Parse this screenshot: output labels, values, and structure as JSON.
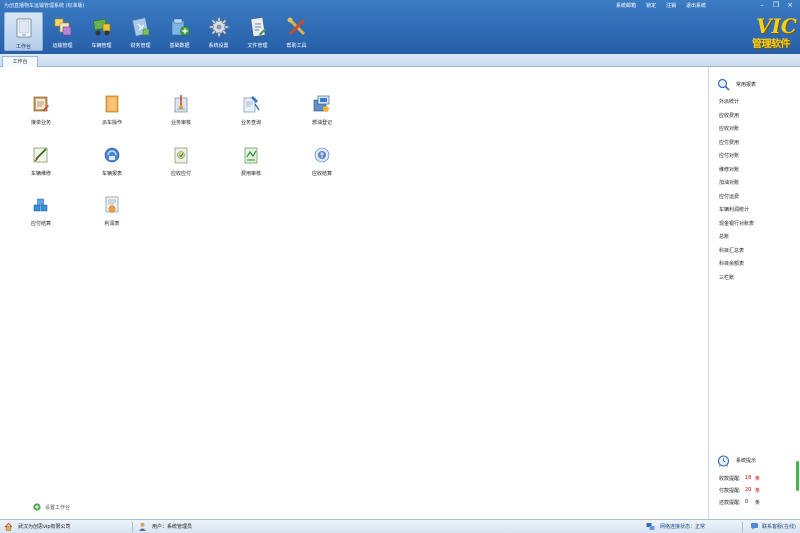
{
  "window": {
    "title": "为创直播物车运输管理系统 (标准版)",
    "top_links": [
      "系统邮箱",
      "锁定",
      "注销",
      "退出系统"
    ],
    "controls": [
      "minimize",
      "restore",
      "close"
    ]
  },
  "toolbar": [
    {
      "label": "工作台",
      "icon": "workbench-icon",
      "active": true
    },
    {
      "label": "运输管理",
      "icon": "transport-icon",
      "active": false
    },
    {
      "label": "车辆管理",
      "icon": "vehicle-icon",
      "active": false
    },
    {
      "label": "财务管理",
      "icon": "finance-icon",
      "active": false
    },
    {
      "label": "基础数据",
      "icon": "basedata-icon",
      "active": false
    },
    {
      "label": "系统设置",
      "icon": "gear-icon",
      "active": false
    },
    {
      "label": "文件管理",
      "icon": "file-icon",
      "active": false
    },
    {
      "label": "帮助工具",
      "icon": "tools-icon",
      "active": false
    }
  ],
  "logo": {
    "vic": "VIC",
    "sub": "管理软件"
  },
  "tabs": [
    {
      "label": "工作台"
    }
  ],
  "workspace": {
    "items": [
      {
        "label": "接单业务",
        "icon": "order-icon"
      },
      {
        "label": "派车操作",
        "icon": "dispatch-icon"
      },
      {
        "label": "业务审核",
        "icon": "audit-icon"
      },
      {
        "label": "业务查询",
        "icon": "query-icon"
      },
      {
        "label": "燃油登记",
        "icon": "fuel-icon"
      },
      {
        "label": "车辆维修",
        "icon": "repair-icon"
      },
      {
        "label": "车辆报表",
        "icon": "vehicle-report-icon"
      },
      {
        "label": "应收应付",
        "icon": "receivable-icon"
      },
      {
        "label": "费用审核",
        "icon": "expense-audit-icon"
      },
      {
        "label": "应收结算",
        "icon": "receivable-settle-icon"
      },
      {
        "label": "应付结算",
        "icon": "payable-settle-icon"
      },
      {
        "label": "利润表",
        "icon": "profit-icon"
      }
    ],
    "setup_label": "设置工作台"
  },
  "reports": {
    "title": "常用报表",
    "items": [
      "外派统计",
      "应收费用",
      "应收对账",
      "应付费用",
      "应付对账",
      "维修对账",
      "加油对账",
      "应付运费",
      "车辆利润统计",
      "现金银行对账表",
      "总账",
      "科目汇总表",
      "科目余额表",
      "三栏账"
    ]
  },
  "tips": {
    "title": "系统提示",
    "items": [
      {
        "label": "收款提醒:",
        "value": "18",
        "unit": "条",
        "highlight": true
      },
      {
        "label": "付款提醒:",
        "value": "20",
        "unit": "条",
        "highlight": true
      },
      {
        "label": "还款提醒:",
        "value": "0",
        "unit": "条",
        "highlight": false
      }
    ]
  },
  "status": {
    "company": "武汉为创思vip有限公司",
    "user": "用户：系统管理员",
    "network": "网络连接状态：正常",
    "feedback": "联系客服(在线)"
  },
  "colors": {
    "header": "#2e6ab4",
    "tab_bar": "#c9d9ec",
    "alert": "#d40000",
    "logo": "#f4d01c"
  }
}
